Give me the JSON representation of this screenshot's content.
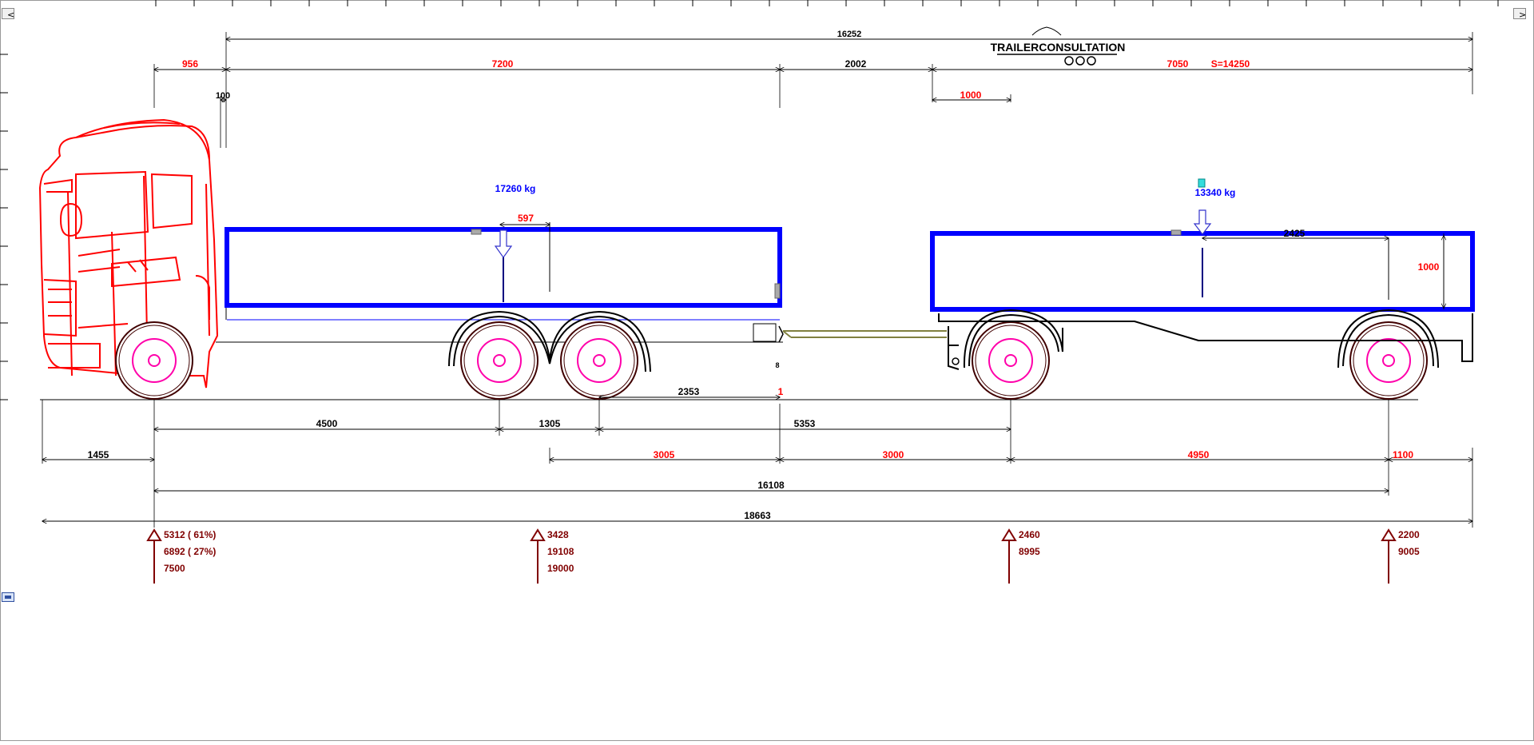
{
  "nav": {
    "left_glyph": "<",
    "right_glyph": ">"
  },
  "logo": {
    "text": "TRAILERCONSULTATION"
  },
  "colors": {
    "truck": "#ff0000",
    "body": "#0000ff",
    "wheel": "#ff00aa",
    "dim": "#000000",
    "dim_red": "#ff0000",
    "axle_arrow": "#800000",
    "drawbar": "#808040"
  },
  "dimensions": {
    "overall_body": "16252",
    "front_overhang": "956",
    "truck_body": "7200",
    "gap": "2002",
    "trailer_body": "7050",
    "total_body": "S=14250",
    "cab_gap": "100",
    "trailer_offset": "1000",
    "load_offset_truck": "597",
    "load_offset_trailer": "2425",
    "body_height": "1000",
    "coupling": "2353",
    "marker_a": "1",
    "marker_b": "8",
    "wheelbase": "4500",
    "tandem": "1305",
    "drawbar_len": "5353",
    "front_to_axle": "1455",
    "d3005": "3005",
    "d3000": "3000",
    "d4950": "4950",
    "d1100": "1100",
    "d16108": "16108",
    "d18663": "18663"
  },
  "loads": {
    "truck_load": "17260 kg",
    "trailer_load": "13340 kg"
  },
  "axles": {
    "front": [
      "5312 ( 61%)",
      "6892 ( 27%)",
      "7500"
    ],
    "rear": [
      "3428",
      "19108",
      "19000"
    ],
    "trailer_front": [
      "2460",
      "8995"
    ],
    "trailer_rear": [
      "2200",
      "9005"
    ]
  }
}
